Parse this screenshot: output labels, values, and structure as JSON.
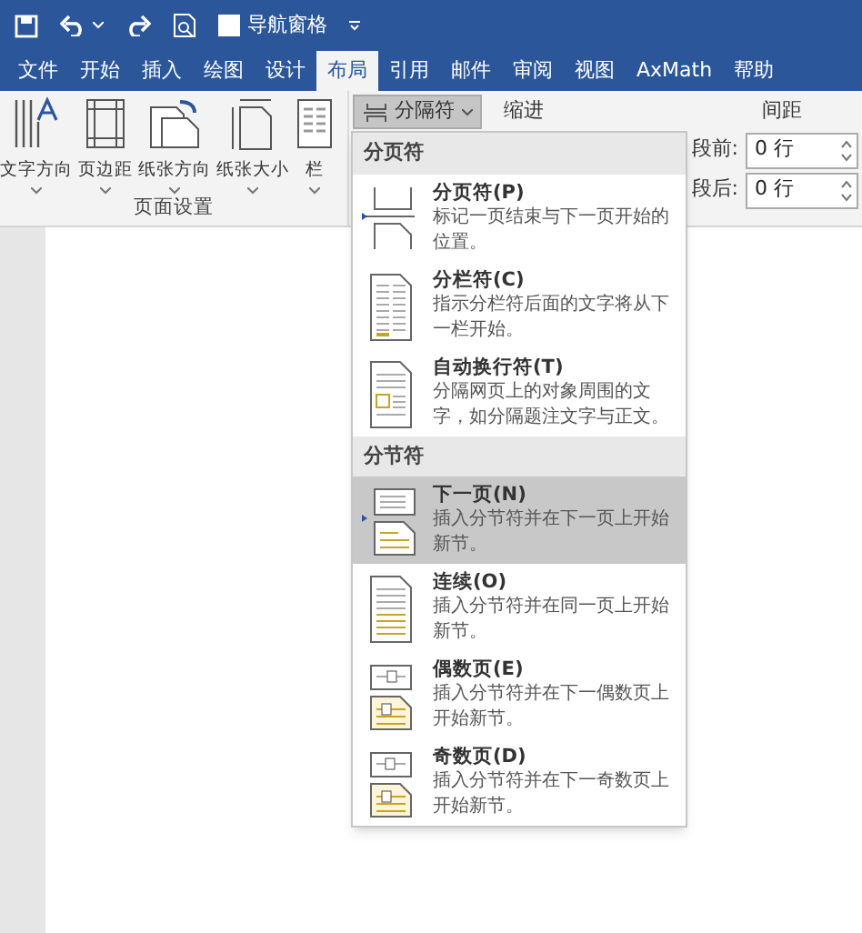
{
  "quick_access": {
    "nav_pane": {
      "label": "导航窗格",
      "checked": false
    }
  },
  "tabs": [
    {
      "label": "文件",
      "selected": false
    },
    {
      "label": "开始",
      "selected": false
    },
    {
      "label": "插入",
      "selected": false
    },
    {
      "label": "绘图",
      "selected": false
    },
    {
      "label": "设计",
      "selected": false
    },
    {
      "label": "布局",
      "selected": true
    },
    {
      "label": "引用",
      "selected": false
    },
    {
      "label": "邮件",
      "selected": false
    },
    {
      "label": "审阅",
      "selected": false
    },
    {
      "label": "视图",
      "selected": false
    },
    {
      "label": "AxMath",
      "selected": false
    },
    {
      "label": "帮助",
      "selected": false
    }
  ],
  "ribbon": {
    "page_setup": {
      "buttons": [
        {
          "label": "文字方向",
          "kind": "text-direction"
        },
        {
          "label": "页边距",
          "kind": "margins"
        },
        {
          "label": "纸张方向",
          "kind": "orientation"
        },
        {
          "label": "纸张大小",
          "kind": "size"
        },
        {
          "label": "栏",
          "kind": "columns"
        }
      ],
      "group_label": "页面设置"
    },
    "breaks_button": {
      "label": "分隔符",
      "pressed": true
    },
    "indent_label": "缩进",
    "spacing_label": "间距",
    "spacing": [
      {
        "label": "段前:",
        "value": "0 行"
      },
      {
        "label": "段后:",
        "value": "0 行"
      }
    ]
  },
  "breaks_menu": [
    {
      "header": "分页符",
      "items": [
        {
          "title": "分页符(P)",
          "description": "标记一页结束与下一页开始的位置。",
          "kind": "page",
          "selected": false
        },
        {
          "title": "分栏符(C)",
          "description": "指示分栏符后面的文字将从下一栏开始。",
          "kind": "column",
          "selected": false
        },
        {
          "title": "自动换行符(T)",
          "description": "分隔网页上的对象周围的文字，如分隔题注文字与正文。",
          "kind": "wrap",
          "selected": false
        }
      ]
    },
    {
      "header": "分节符",
      "items": [
        {
          "title": "下一页(N)",
          "description": "插入分节符并在下一页上开始新节。",
          "kind": "next",
          "selected": true
        },
        {
          "title": "连续(O)",
          "description": "插入分节符并在同一页上开始新节。",
          "kind": "continuous",
          "selected": false
        },
        {
          "title": "偶数页(E)",
          "description": "插入分节符并在下一偶数页上开始新节。",
          "kind": "even",
          "selected": false
        },
        {
          "title": "奇数页(D)",
          "description": "插入分节符并在下一奇数页上开始新节。",
          "kind": "odd",
          "selected": false
        }
      ]
    }
  ]
}
